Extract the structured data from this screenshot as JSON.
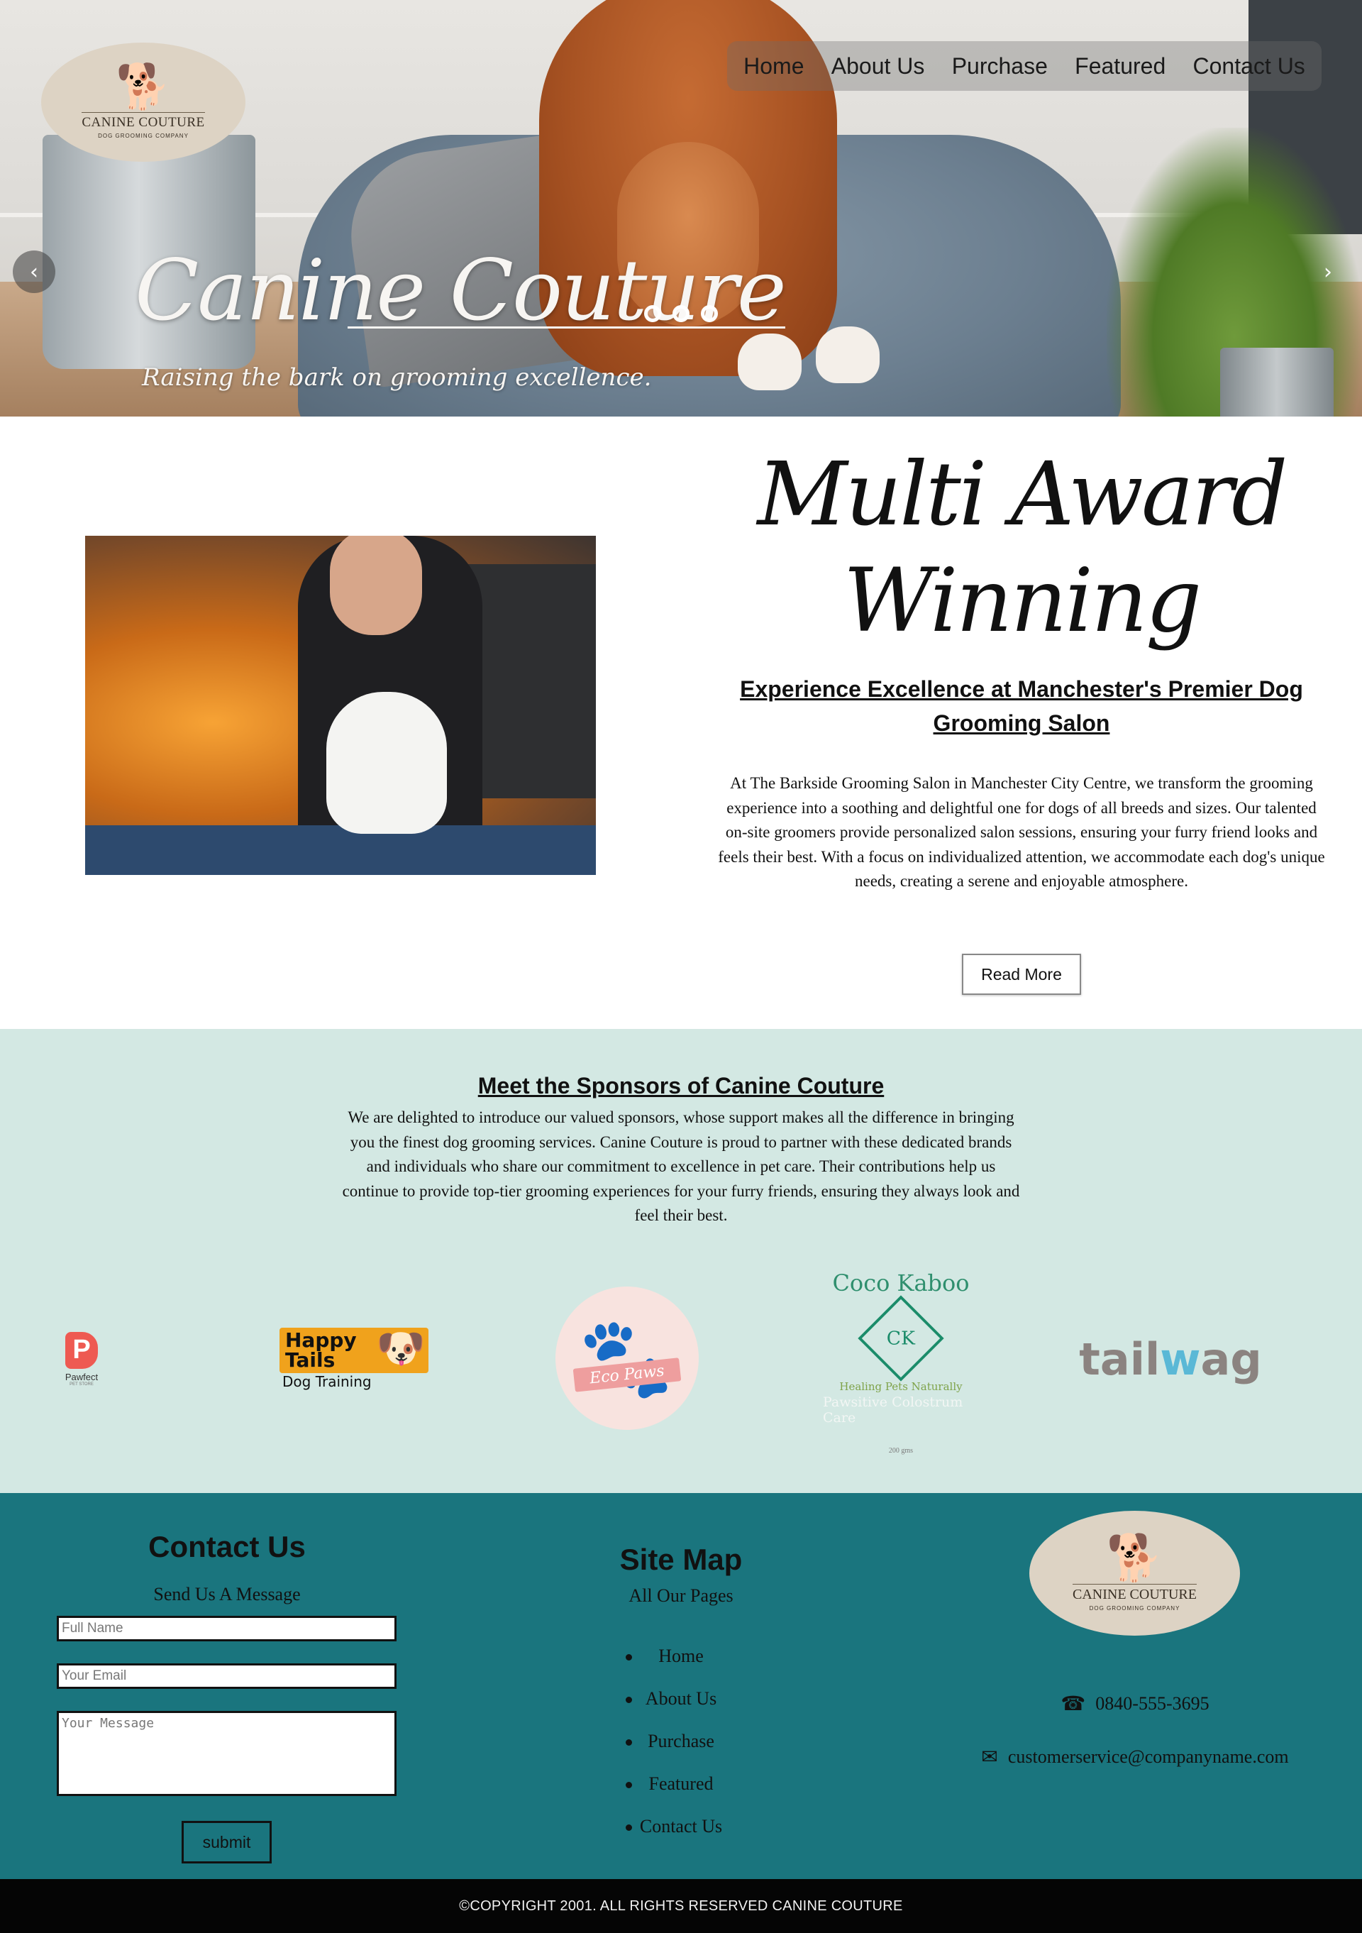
{
  "nav": {
    "items": [
      {
        "label": "Home"
      },
      {
        "label": "About Us"
      },
      {
        "label": "Purchase"
      },
      {
        "label": "Featured"
      },
      {
        "label": "Contact Us"
      }
    ]
  },
  "logo": {
    "name": "CANINE COUTURE",
    "tagline": "DOG GROOMING COMPANY",
    "icon": "dog-silhouette-icon"
  },
  "hero": {
    "title": "Canine Couture",
    "subtitle": "Raising the bark on grooming excellence.",
    "prev_arrow": "‹",
    "next_arrow": "›",
    "slides_count": 3
  },
  "award": {
    "script_title": "Multi Award Winning",
    "heading": "Experience Excellence at Manchester's Premier Dog Grooming Salon",
    "body": "At The Barkside Grooming Salon in Manchester City Centre, we transform the grooming experience into a soothing and delightful one for dogs of all breeds and sizes. Our talented on-site groomers provide personalized salon sessions, ensuring your furry friend looks and feels their best. With a focus on individualized attention, we accommodate each dog's unique needs, creating a serene and enjoyable atmosphere.",
    "button_label": "Read More"
  },
  "sponsors": {
    "heading": "Meet the Sponsors of Canine Couture",
    "body": "We are delighted to introduce our valued sponsors, whose support makes all the difference in bringing you the finest dog grooming services. Canine Couture is proud to partner with these dedicated brands and individuals who share our commitment to excellence in pet care. Their contributions help us continue to provide top-tier grooming experiences for your furry friends, ensuring they always look and feel their best.",
    "logos": {
      "pawfect": {
        "mark": "P",
        "name": "Pawfect",
        "sub": "PET STORE"
      },
      "happy_tails": {
        "line1": "Happy",
        "line2": "Tails",
        "sub": "Dog Training"
      },
      "eco_paws": {
        "name": "Eco Paws"
      },
      "coco_kaboo": {
        "name": "Coco Kaboo",
        "mark": "CK",
        "tag": "Healing Pets Naturally",
        "tag2": "Pawsitive Colostrum Care",
        "tag3": "200 gms"
      },
      "tailwag": {
        "part1": "tail",
        "part2": "w",
        "part3": "ag"
      }
    }
  },
  "footer": {
    "contact": {
      "title": "Contact Us",
      "subtitle": "Send Us A Message",
      "name_placeholder": "Full Name",
      "email_placeholder": "Your Email",
      "message_placeholder": "Your Message",
      "submit_label": "submit"
    },
    "sitemap": {
      "title": "Site Map",
      "subtitle": "All Our Pages",
      "links": [
        {
          "label": "Home"
        },
        {
          "label": "About Us"
        },
        {
          "label": "Purchase"
        },
        {
          "label": "Featured"
        },
        {
          "label": "Contact Us"
        }
      ]
    },
    "info": {
      "phone": "0840-555-3695",
      "email": "customerservice@companyname.com",
      "phone_icon": "phone-icon",
      "email_icon": "envelope-icon"
    }
  },
  "copyright": "©COPYRIGHT 2001. ALL RIGHTS RESERVED CANINE COUTURE",
  "colors": {
    "sponsors_bg": "#d3e8e3",
    "footer_bg": "#1a757e",
    "copyright_bg": "#050505"
  }
}
